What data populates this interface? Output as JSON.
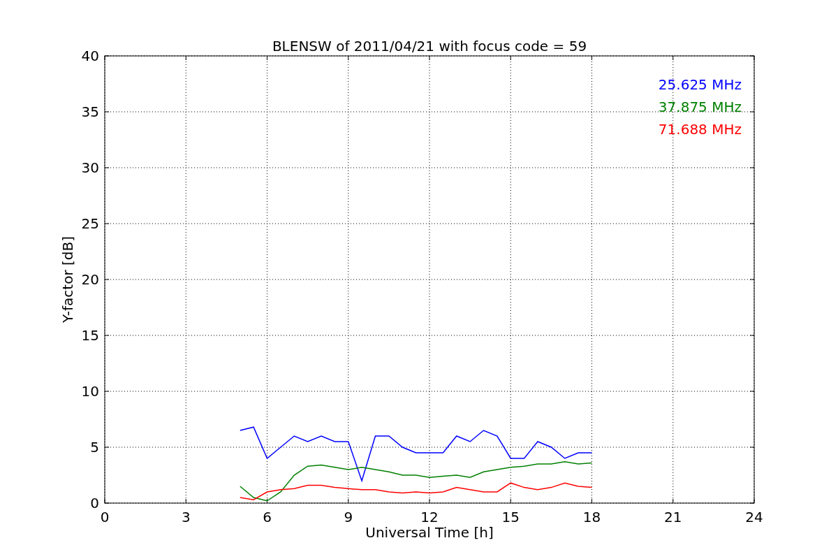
{
  "figure": {
    "chart_data": {
      "type": "line",
      "title": "BLENSW of 2011/04/21 with focus code = 59",
      "xlabel": "Universal Time [h]",
      "ylabel": "Y-factor [dB]",
      "x": [
        5,
        5.5,
        6,
        6.5,
        7,
        7.5,
        8,
        8.5,
        9,
        9.5,
        10,
        10.5,
        11,
        11.5,
        12,
        12.5,
        13,
        13.5,
        14,
        14.5,
        15,
        15.5,
        16,
        16.5,
        17,
        17.5,
        18
      ],
      "series": [
        {
          "name": "25.625 MHz",
          "color": "#0000ff",
          "values": [
            6.5,
            6.8,
            4,
            5,
            6,
            5.5,
            6,
            5.5,
            5.5,
            2,
            6,
            6,
            5,
            4.5,
            4.5,
            4.5,
            6,
            5.5,
            6.5,
            6,
            4,
            4,
            5.5,
            5,
            4,
            4.5,
            4.5
          ]
        },
        {
          "name": "37.875 MHz",
          "color": "#008000",
          "values": [
            1.5,
            0.5,
            0.2,
            1,
            2.5,
            3.3,
            3.4,
            3.2,
            3,
            3.2,
            3,
            2.8,
            2.5,
            2.5,
            2.3,
            2.4,
            2.5,
            2.3,
            2.8,
            3,
            3.2,
            3.3,
            3.5,
            3.5,
            3.7,
            3.5,
            3.6
          ]
        },
        {
          "name": "71.688 MHz",
          "color": "#ff0000",
          "values": [
            0.5,
            0.3,
            1,
            1.2,
            1.3,
            1.6,
            1.6,
            1.4,
            1.3,
            1.2,
            1.2,
            1,
            0.9,
            1,
            0.9,
            1,
            1.4,
            1.2,
            1,
            1,
            1.8,
            1.4,
            1.2,
            1.4,
            1.8,
            1.5,
            1.4
          ]
        }
      ],
      "grid": true,
      "xlim": [
        0,
        24
      ],
      "ylim": [
        0,
        40
      ],
      "xticks": [
        0,
        3,
        6,
        9,
        12,
        15,
        18,
        21,
        24
      ],
      "yticks": [
        0,
        5,
        10,
        15,
        20,
        25,
        30,
        35,
        40
      ]
    }
  }
}
